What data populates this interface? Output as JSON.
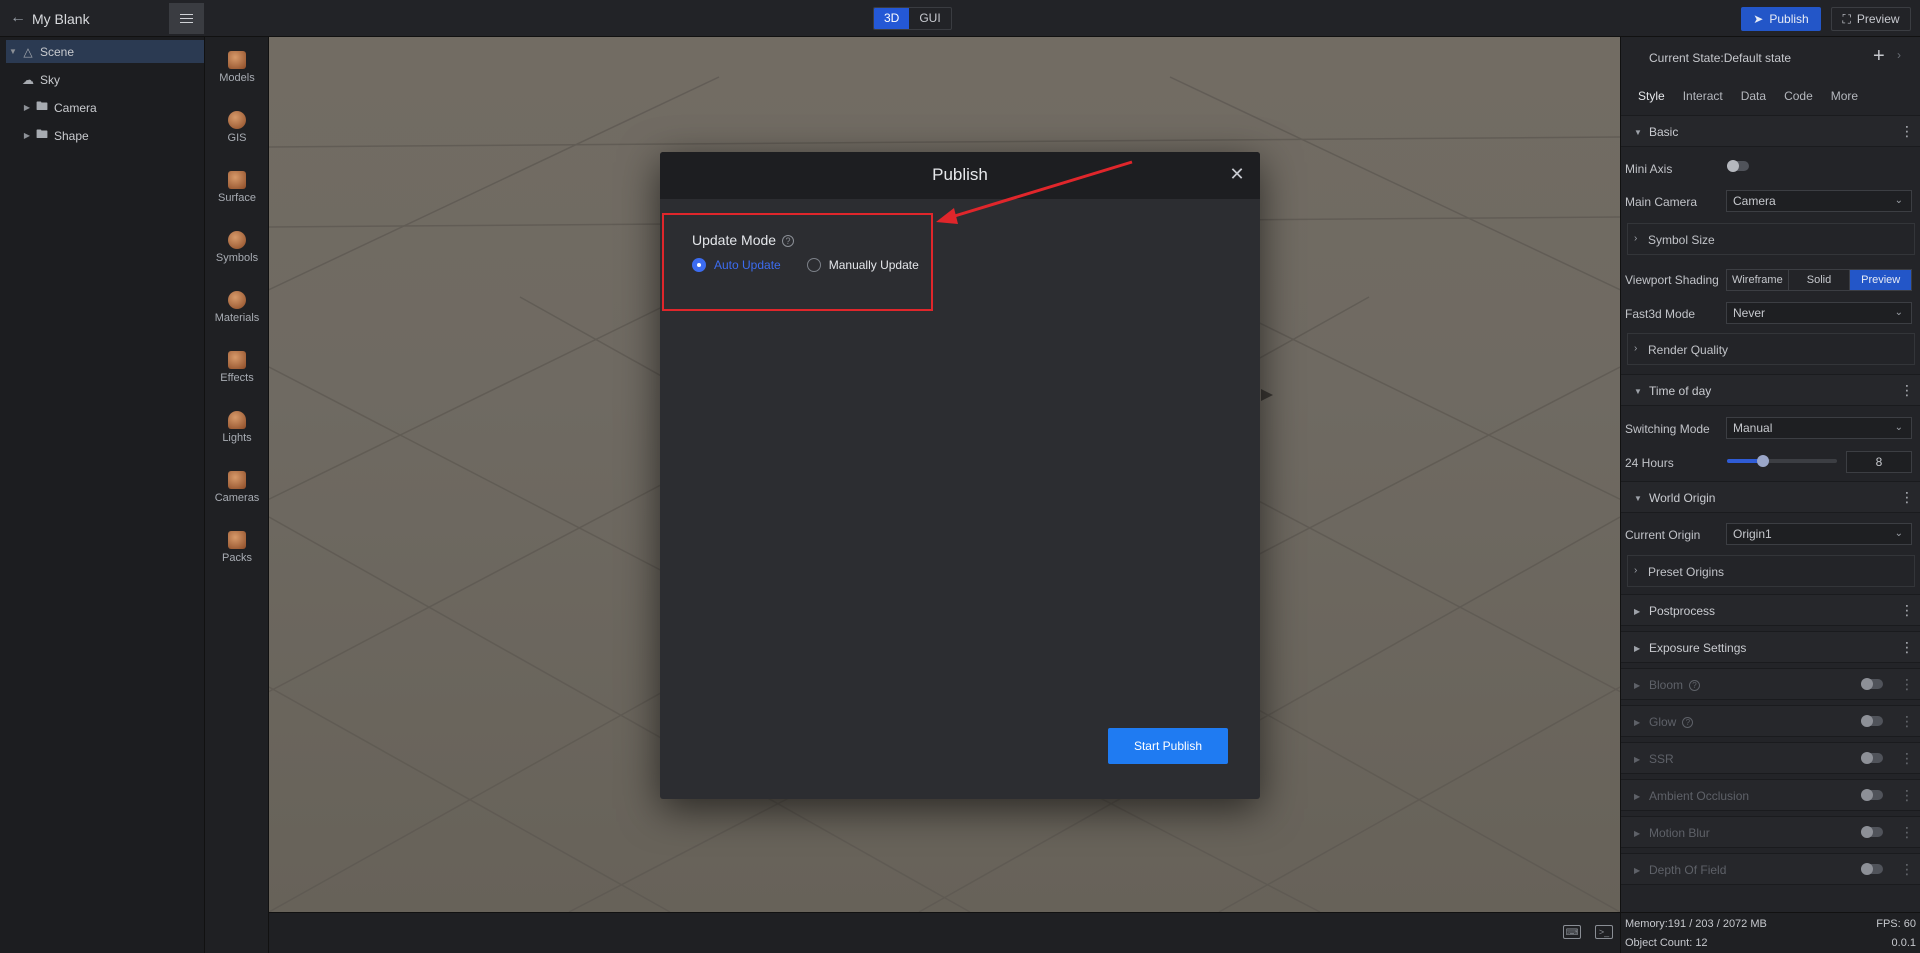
{
  "header": {
    "title": "My Blank",
    "mode_3d": "3D",
    "mode_gui": "GUI",
    "publish_label": "Publish",
    "preview_label": "Preview"
  },
  "tree": {
    "items": [
      {
        "label": "Scene",
        "icon": "scene-icon"
      },
      {
        "label": "Sky",
        "icon": "sky-icon"
      },
      {
        "label": "Camera",
        "icon": "folder-icon"
      },
      {
        "label": "Shape",
        "icon": "folder-icon"
      }
    ]
  },
  "assets": {
    "items": [
      {
        "label": "Models"
      },
      {
        "label": "GIS"
      },
      {
        "label": "Surface"
      },
      {
        "label": "Symbols"
      },
      {
        "label": "Materials"
      },
      {
        "label": "Effects"
      },
      {
        "label": "Lights"
      },
      {
        "label": "Cameras"
      },
      {
        "label": "Packs"
      }
    ]
  },
  "modal": {
    "title": "Publish",
    "update_mode_label": "Update Mode",
    "option_auto": "Auto Update",
    "option_manual": "Manually Update",
    "start_label": "Start Publish"
  },
  "panel": {
    "current_state": "Current State:Default state",
    "tabs": [
      "Style",
      "Interact",
      "Data",
      "Code",
      "More"
    ],
    "basic": "Basic",
    "mini_axis": "Mini Axis",
    "main_camera": "Main Camera",
    "main_camera_value": "Camera",
    "symbol_size": "Symbol Size",
    "viewport_shading": "Viewport Shading",
    "shading_options": [
      "Wireframe",
      "Solid",
      "Preview"
    ],
    "fast3d_mode": "Fast3d Mode",
    "fast3d_value": "Never",
    "render_quality": "Render Quality",
    "time_of_day": "Time of day",
    "switching_mode": "Switching Mode",
    "switching_value": "Manual",
    "hours_label": "24 Hours",
    "hours_value": "8",
    "hours_fraction": 0.33,
    "world_origin": "World Origin",
    "current_origin": "Current Origin",
    "current_origin_value": "Origin1",
    "preset_origins": "Preset Origins",
    "postprocess": "Postprocess",
    "exposure": "Exposure Settings",
    "bloom": "Bloom",
    "glow": "Glow",
    "ssr": "SSR",
    "ambient_occlusion": "Ambient Occlusion",
    "motion_blur": "Motion Blur",
    "depth_of_field": "Depth Of Field"
  },
  "footer": {
    "memory": "Memory:191 / 203 / 2072 MB",
    "fps": "FPS: 60",
    "object_count": "Object Count: 12",
    "version": "0.0.1"
  }
}
